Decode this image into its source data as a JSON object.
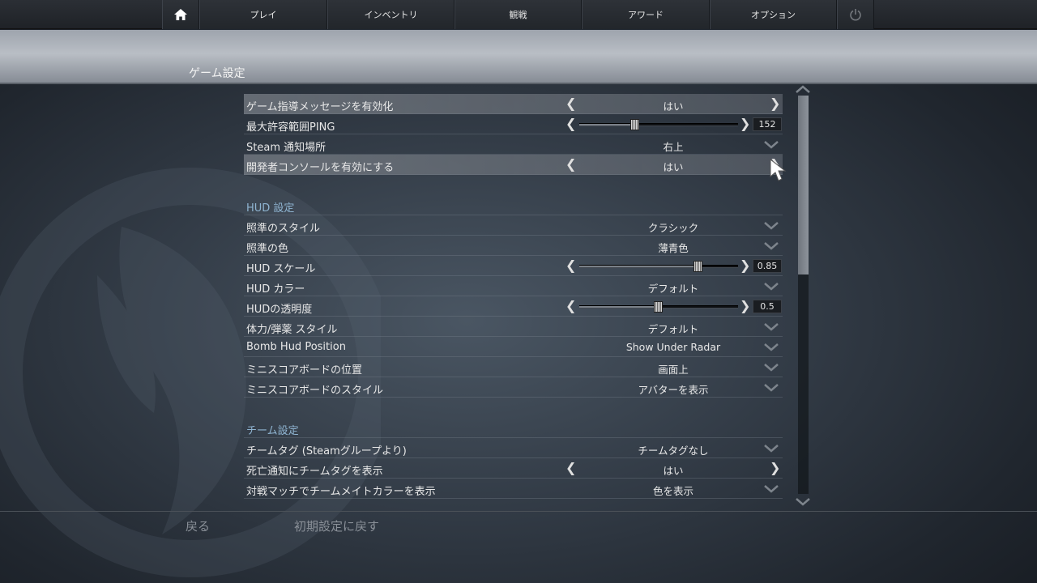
{
  "nav": {
    "items": [
      {
        "label": "プレイ"
      },
      {
        "label": "インベントリ"
      },
      {
        "label": "観戦"
      },
      {
        "label": "アワード"
      },
      {
        "label": "オプション"
      }
    ],
    "home_icon": "home-icon",
    "power_icon": "power-icon"
  },
  "page": {
    "title": "ゲーム設定"
  },
  "settings": {
    "general": [
      {
        "label": "ゲーム指導メッセージを有効化",
        "value": "はい",
        "type": "cycle"
      },
      {
        "label": "最大許容範囲PING",
        "value": "152",
        "type": "slider",
        "fraction": 0.35
      },
      {
        "label": "Steam 通知場所",
        "value": "右上",
        "type": "dropdown"
      },
      {
        "label": "開発者コンソールを有効にする",
        "value": "はい",
        "type": "cycle"
      }
    ],
    "hud_header": "HUD 設定",
    "hud": [
      {
        "label": "照準のスタイル",
        "value": "クラシック",
        "type": "dropdown"
      },
      {
        "label": "照準の色",
        "value": "薄青色",
        "type": "dropdown"
      },
      {
        "label": "HUD スケール",
        "value": "0.85",
        "type": "slider",
        "fraction": 0.75
      },
      {
        "label": "HUD カラー",
        "value": "デフォルト",
        "type": "dropdown"
      },
      {
        "label": "HUDの透明度",
        "value": "0.5",
        "type": "slider",
        "fraction": 0.5
      },
      {
        "label": "体力/弾薬 スタイル",
        "value": "デフォルト",
        "type": "dropdown"
      },
      {
        "label": "Bomb Hud Position",
        "value": "Show Under Radar",
        "type": "dropdown"
      },
      {
        "label": "ミニスコアボードの位置",
        "value": "画面上",
        "type": "dropdown"
      },
      {
        "label": "ミニスコアボードのスタイル",
        "value": "アバターを表示",
        "type": "dropdown"
      }
    ],
    "team_header": "チーム設定",
    "team": [
      {
        "label": "チームタグ (Steamグループより)",
        "value": "チームタグなし",
        "type": "dropdown"
      },
      {
        "label": "死亡通知にチームタグを表示",
        "value": "はい",
        "type": "cycle"
      },
      {
        "label": "対戦マッチでチームメイトカラーを表示",
        "value": "色を表示",
        "type": "dropdown"
      }
    ]
  },
  "scrollbar": {
    "position_fraction": 0.0,
    "visible_fraction": 0.45
  },
  "footer": {
    "back_label": "戻る",
    "reset_label": "初期設定に戻す"
  },
  "colors": {
    "section_header": "#8fb4d1",
    "highlight_row": "#6f757d"
  }
}
